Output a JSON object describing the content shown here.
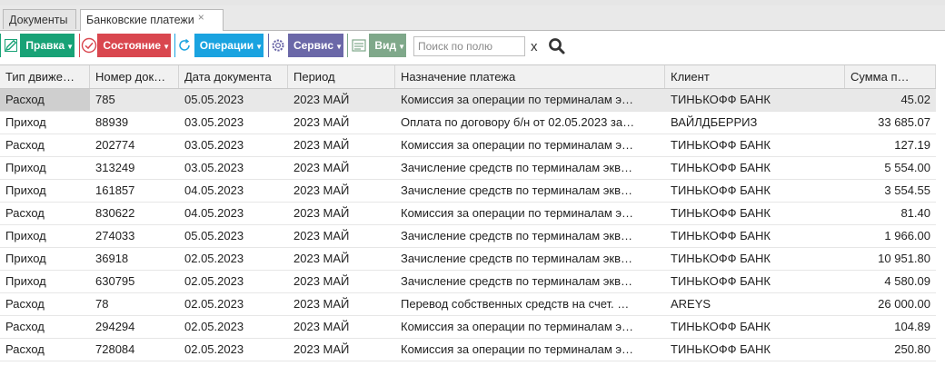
{
  "tabs": [
    {
      "label": "Документы"
    },
    {
      "label": "Банковские платежи",
      "close": "×"
    }
  ],
  "toolbar": {
    "buttons": [
      {
        "label": "Правка",
        "color": "#18a276",
        "icon": "pencil-icon"
      },
      {
        "label": "Состояние",
        "color": "#d9474f",
        "icon": "check-circle-icon"
      },
      {
        "label": "Операции",
        "color": "#1aa3e0",
        "icon": "refresh-icon"
      },
      {
        "label": "Сервис",
        "color": "#6b68a8",
        "icon": "gear-icon"
      },
      {
        "label": "Вид",
        "color": "#7fa88a",
        "icon": "view-list-icon"
      }
    ],
    "search_placeholder": "Поиск по полю",
    "clear": "x"
  },
  "columns": [
    "Тип движе…",
    "Номер док…",
    "Дата документа",
    "Период",
    "Назначение платежа",
    "Клиент",
    "Сумма п…"
  ],
  "rows": [
    [
      "Расход",
      "785",
      "05.05.2023",
      "2023 МАЙ",
      "Комиссия за операции по терминалам э…",
      "ТИНЬКОФФ БАНК",
      "45.02"
    ],
    [
      "Приход",
      "88939",
      "03.05.2023",
      "2023 МАЙ",
      "Оплата по договору б/н от 02.05.2023 за…",
      "ВАЙЛДБЕРРИЗ",
      "33 685.07"
    ],
    [
      "Расход",
      "202774",
      "03.05.2023",
      "2023 МАЙ",
      "Комиссия за операции по терминалам э…",
      "ТИНЬКОФФ БАНК",
      "127.19"
    ],
    [
      "Приход",
      "313249",
      "03.05.2023",
      "2023 МАЙ",
      "Зачисление средств по терминалам экв…",
      "ТИНЬКОФФ БАНК",
      "5 554.00"
    ],
    [
      "Приход",
      "161857",
      "04.05.2023",
      "2023 МАЙ",
      "Зачисление средств по терминалам экв…",
      "ТИНЬКОФФ БАНК",
      "3 554.55"
    ],
    [
      "Расход",
      "830622",
      "04.05.2023",
      "2023 МАЙ",
      "Комиссия за операции по терминалам э…",
      "ТИНЬКОФФ БАНК",
      "81.40"
    ],
    [
      "Приход",
      "274033",
      "05.05.2023",
      "2023 МАЙ",
      "Зачисление средств по терминалам экв…",
      "ТИНЬКОФФ БАНК",
      "1 966.00"
    ],
    [
      "Приход",
      "36918",
      "02.05.2023",
      "2023 МАЙ",
      "Зачисление средств по терминалам экв…",
      "ТИНЬКОФФ БАНК",
      "10 951.80"
    ],
    [
      "Приход",
      "630795",
      "02.05.2023",
      "2023 МАЙ",
      "Зачисление средств по терминалам экв…",
      "ТИНЬКОФФ БАНК",
      "4 580.09"
    ],
    [
      "Расход",
      "78",
      "02.05.2023",
      "2023 МАЙ",
      "Перевод собственных средств на счет. …",
      "AREYS",
      "26 000.00"
    ],
    [
      "Расход",
      "294294",
      "02.05.2023",
      "2023 МАЙ",
      "Комиссия за операции по терминалам э…",
      "ТИНЬКОФФ БАНК",
      "104.89"
    ],
    [
      "Расход",
      "728084",
      "02.05.2023",
      "2023 МАЙ",
      "Комиссия за операции по терминалам э…",
      "ТИНЬКОФФ БАНК",
      "250.80"
    ]
  ]
}
